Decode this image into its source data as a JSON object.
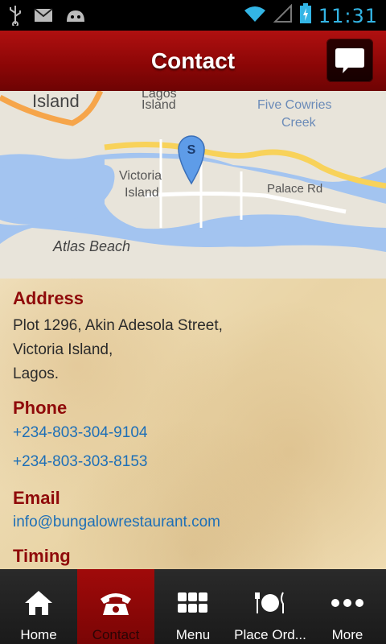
{
  "status_bar": {
    "time": "11:31",
    "icons": [
      "usb-icon",
      "gmail-icon",
      "android-icon",
      "wifi-icon",
      "signal-icon",
      "battery-icon"
    ]
  },
  "header": {
    "title": "Contact",
    "chat_icon": "chat-bubble-icon"
  },
  "map": {
    "labels": [
      "Island",
      "Lagos Island",
      "Five Cowries Creek",
      "Victoria Island",
      "Palace Rd",
      "Atlas Beach"
    ],
    "marker_letter": "S"
  },
  "contact": {
    "address": {
      "title": "Address",
      "lines": [
        "Plot 1296, Akin Adesola Street,",
        "Victoria Island,",
        "Lagos."
      ]
    },
    "phone": {
      "title": "Phone",
      "numbers": [
        "+234-803-304-9104",
        "+234-803-303-8153"
      ]
    },
    "email": {
      "title": "Email",
      "value": "info@bungalowrestaurant.com"
    },
    "timing": {
      "title": "Timing"
    }
  },
  "nav": {
    "items": [
      {
        "label": "Home",
        "icon": "home-icon"
      },
      {
        "label": "Contact",
        "icon": "phone-icon",
        "active": true
      },
      {
        "label": "Menu",
        "icon": "grid-icon"
      },
      {
        "label": "Place Ord...",
        "icon": "dining-icon"
      },
      {
        "label": "More",
        "icon": "more-dots-icon"
      }
    ]
  },
  "colors": {
    "header": "#9a0808",
    "section_title": "#8f0a0a",
    "link": "#1d6fb7",
    "status_time": "#33b5e5"
  }
}
